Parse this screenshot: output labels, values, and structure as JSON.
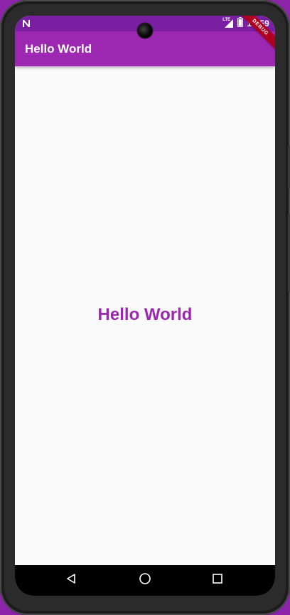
{
  "status_bar": {
    "time": "10:59",
    "network_label": "LTE",
    "left_icon": "notification-n-icon",
    "icons": [
      "lte-signal-icon",
      "battery-icon"
    ]
  },
  "app_bar": {
    "title": "Hello World"
  },
  "debug_banner": {
    "label": "DEBUG"
  },
  "body": {
    "text": "Hello World"
  },
  "nav_bar": {
    "icons": [
      "back-icon",
      "home-icon",
      "recents-icon"
    ]
  },
  "colors": {
    "primary": "#9c27b0",
    "primary_dark": "#7b1fa2",
    "background": "#fafafa",
    "debug_banner": "#b00020",
    "nav_bar": "#000000"
  }
}
